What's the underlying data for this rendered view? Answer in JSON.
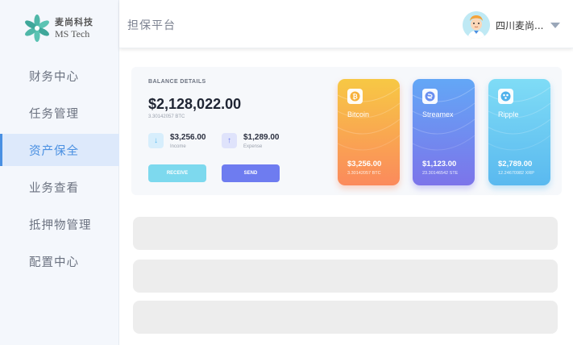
{
  "sidebar": {
    "logo": {
      "cn": "麦尚科技",
      "en": "MS Tech"
    },
    "items": [
      {
        "label": "财务中心",
        "active": false
      },
      {
        "label": "任务管理",
        "active": false
      },
      {
        "label": "资产保全",
        "active": true
      },
      {
        "label": "业务查看",
        "active": false
      },
      {
        "label": "抵押物管理",
        "active": false
      },
      {
        "label": "配置中心",
        "active": false
      }
    ]
  },
  "header": {
    "title": "担保平台",
    "username": "四川麦尚..."
  },
  "balance": {
    "label": "BALANCE DETAILS",
    "amount": "$2,128,022.00",
    "btc": "3.30142057 BTC",
    "income": {
      "amount": "$3,256.00",
      "label": "Income",
      "icon": "arrow-down-icon"
    },
    "expense": {
      "amount": "$1,289.00",
      "label": "Expense",
      "icon": "arrow-up-icon"
    },
    "receive_label": "RECEIVE",
    "send_label": "SEND"
  },
  "cards": [
    {
      "name": "Bitcoin",
      "amount": "$3,256.00",
      "sub": "3.30142057 BTC",
      "icon": "bitcoin-icon",
      "colors": [
        "#f7c844",
        "#fb8a5c"
      ]
    },
    {
      "name": "Streamex",
      "amount": "$1,123.00",
      "sub": "23.30146542 STE",
      "icon": "streamex-icon",
      "colors": [
        "#63a7f6",
        "#7c74ea"
      ]
    },
    {
      "name": "Ripple",
      "amount": "$2,789.00",
      "sub": "12.24670982 XRP",
      "icon": "ripple-icon",
      "colors": [
        "#7fdcf6",
        "#5ab9ef"
      ]
    }
  ],
  "colors": {
    "accent": "#4a90e2",
    "receive": "#7dd9ee",
    "send": "#6e7cf0"
  }
}
